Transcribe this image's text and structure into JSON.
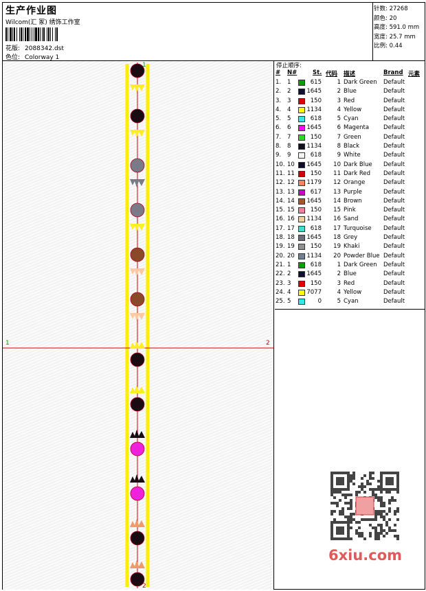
{
  "header": {
    "title": "生产作业图",
    "company": "Wilcom(汇 冢) 绣饰工作室",
    "pattern_label": "花版:",
    "pattern_value": "2088342.dst",
    "colorway_label": "色位:",
    "colorway_value": "Colorway 1"
  },
  "specs": {
    "stitches_label": "针数:",
    "stitches_value": "27268",
    "colors_label": "颜色:",
    "colors_value": "20",
    "height_label": "高度:",
    "height_value": "591.0 mm",
    "width_label": "宽度:",
    "width_value": "25.7 mm",
    "scale_label": "比例:",
    "scale_value": "0.44"
  },
  "canvas": {
    "top_mark_green": "1",
    "bottom_mark_red": "2",
    "left_mark_green": "1",
    "right_mark_red": "2"
  },
  "color_list": {
    "title": "停止顺序:",
    "columns": {
      "idx": "#",
      "n": "N#",
      "st": "St.",
      "code": "代码",
      "desc": "描述",
      "brand": "Brand",
      "element": "元素"
    },
    "rows": [
      {
        "idx": "1.",
        "n": "1",
        "color": "#00a000",
        "st": "615",
        "code": "1",
        "desc": "Dark Green",
        "brand": "Default"
      },
      {
        "idx": "2.",
        "n": "2",
        "color": "#101030",
        "st": "1645",
        "code": "2",
        "desc": "Blue",
        "brand": "Default"
      },
      {
        "idx": "3.",
        "n": "3",
        "color": "#e00000",
        "st": "150",
        "code": "3",
        "desc": "Red",
        "brand": "Default"
      },
      {
        "idx": "4.",
        "n": "4",
        "color": "#ffff00",
        "st": "1134",
        "code": "4",
        "desc": "Yellow",
        "brand": "Default"
      },
      {
        "idx": "5.",
        "n": "5",
        "color": "#33e8e8",
        "st": "618",
        "code": "5",
        "desc": "Cyan",
        "brand": "Default"
      },
      {
        "idx": "6.",
        "n": "6",
        "color": "#ff00ff",
        "st": "1645",
        "code": "6",
        "desc": "Magenta",
        "brand": "Default"
      },
      {
        "idx": "7.",
        "n": "7",
        "color": "#22dd22",
        "st": "150",
        "code": "7",
        "desc": "Green",
        "brand": "Default"
      },
      {
        "idx": "8.",
        "n": "8",
        "color": "#101020",
        "st": "1134",
        "code": "8",
        "desc": "Black",
        "brand": "Default"
      },
      {
        "idx": "9.",
        "n": "9",
        "color": "#f4f4f4",
        "st": "618",
        "code": "9",
        "desc": "White",
        "brand": "Default"
      },
      {
        "idx": "10.",
        "n": "10",
        "color": "#0c0c2a",
        "st": "1645",
        "code": "10",
        "desc": "Dark Blue",
        "brand": "Default"
      },
      {
        "idx": "11.",
        "n": "11",
        "color": "#d00000",
        "st": "150",
        "code": "11",
        "desc": "Dark Red",
        "brand": "Default"
      },
      {
        "idx": "12.",
        "n": "12",
        "color": "#f08858",
        "st": "1179",
        "code": "12",
        "desc": "Orange",
        "brand": "Default"
      },
      {
        "idx": "13.",
        "n": "13",
        "color": "#cc00cc",
        "st": "617",
        "code": "13",
        "desc": "Purple",
        "brand": "Default"
      },
      {
        "idx": "14.",
        "n": "14",
        "color": "#a0582c",
        "st": "1645",
        "code": "14",
        "desc": "Brown",
        "brand": "Default"
      },
      {
        "idx": "15.",
        "n": "15",
        "color": "#f080a0",
        "st": "150",
        "code": "15",
        "desc": "Pink",
        "brand": "Default"
      },
      {
        "idx": "16.",
        "n": "16",
        "color": "#f0d0a0",
        "st": "1134",
        "code": "16",
        "desc": "Sand",
        "brand": "Default"
      },
      {
        "idx": "17.",
        "n": "17",
        "color": "#40e0d0",
        "st": "618",
        "code": "17",
        "desc": "Turquoise",
        "brand": "Default"
      },
      {
        "idx": "18.",
        "n": "18",
        "color": "#6c6c78",
        "st": "1645",
        "code": "18",
        "desc": "Grey",
        "brand": "Default"
      },
      {
        "idx": "19.",
        "n": "19",
        "color": "#909090",
        "st": "150",
        "code": "19",
        "desc": "Khaki",
        "brand": "Default"
      },
      {
        "idx": "20.",
        "n": "20",
        "color": "#708090",
        "st": "1134",
        "code": "20",
        "desc": "Powder Blue",
        "brand": "Default"
      },
      {
        "idx": "21.",
        "n": "1",
        "color": "#00a000",
        "st": "618",
        "code": "1",
        "desc": "Dark Green",
        "brand": "Default"
      },
      {
        "idx": "22.",
        "n": "2",
        "color": "#101030",
        "st": "1645",
        "code": "2",
        "desc": "Blue",
        "brand": "Default"
      },
      {
        "idx": "23.",
        "n": "3",
        "color": "#e00000",
        "st": "150",
        "code": "3",
        "desc": "Red",
        "brand": "Default"
      },
      {
        "idx": "24.",
        "n": "4",
        "color": "#ffff00",
        "st": "7077",
        "code": "4",
        "desc": "Yellow",
        "brand": "Default"
      },
      {
        "idx": "25.",
        "n": "5",
        "color": "#33e8e8",
        "st": "0",
        "code": "5",
        "desc": "Cyan",
        "brand": "Default"
      }
    ]
  },
  "watermark": {
    "text": "6xiu.com",
    "qr_stamp": "qr-code-icon"
  },
  "design_motifs": {
    "motif": "pineapple-icon",
    "colors": [
      "#1a0a14",
      "#ffee22",
      "#7a7a88",
      "#8a4a2a",
      "#ffc8a0",
      "#ee22dd",
      "#f09a6a"
    ]
  }
}
